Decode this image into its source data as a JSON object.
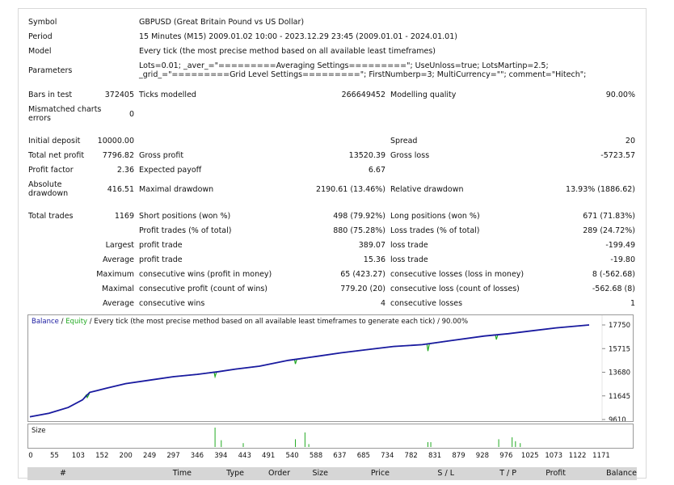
{
  "report": {
    "symbol": {
      "label": "Symbol",
      "value": "GBPUSD (Great Britain Pound vs US Dollar)"
    },
    "period": {
      "label": "Period",
      "value": "15 Minutes (M15) 2009.01.02 10:00 - 2023.12.29 23:45 (2009.01.01 - 2024.01.01)"
    },
    "model": {
      "label": "Model",
      "value": "Every tick (the most precise method based on all available least timeframes)"
    },
    "parameters": {
      "label": "Parameters",
      "value": "Lots=0.01; _aver_=\"=========Averaging Settings=========\"; UseUnloss=true; LotsMartinp=2.5; _grid_=\"=========Grid Level Settings=========\"; FirstNumberp=3; MultiCurrency=\"\"; comment=\"Hitech\";"
    },
    "bars_in_test": {
      "label": "Bars in test",
      "value": "372405"
    },
    "ticks_modelled": {
      "label": "Ticks modelled",
      "value": "266649452"
    },
    "modelling_quality": {
      "label": "Modelling quality",
      "value": "90.00%"
    },
    "mismatched": {
      "label": "Mismatched charts errors",
      "value": "0"
    },
    "initial_deposit": {
      "label": "Initial deposit",
      "value": "10000.00"
    },
    "spread": {
      "label": "Spread",
      "value": "20"
    },
    "total_net_profit": {
      "label": "Total net profit",
      "value": "7796.82"
    },
    "gross_profit": {
      "label": "Gross profit",
      "value": "13520.39"
    },
    "gross_loss": {
      "label": "Gross loss",
      "value": "-5723.57"
    },
    "profit_factor": {
      "label": "Profit factor",
      "value": "2.36"
    },
    "expected_payoff": {
      "label": "Expected payoff",
      "value": "6.67"
    },
    "absolute_drawdown": {
      "label": "Absolute drawdown",
      "value": "416.51"
    },
    "maximal_drawdown": {
      "label": "Maximal drawdown",
      "value": "2190.61 (13.46%)"
    },
    "relative_drawdown": {
      "label": "Relative drawdown",
      "value": "13.93% (1886.62)"
    },
    "total_trades": {
      "label": "Total trades",
      "value": "1169"
    },
    "short_positions": {
      "label": "Short positions (won %)",
      "value": "498 (79.92%)"
    },
    "long_positions": {
      "label": "Long positions (won %)",
      "value": "671 (71.83%)"
    },
    "profit_trades": {
      "label": "Profit trades (% of total)",
      "value": "880 (75.28%)"
    },
    "loss_trades": {
      "label": "Loss trades (% of total)",
      "value": "289 (24.72%)"
    },
    "largest": {
      "label": "Largest",
      "profit_label": "profit trade",
      "profit": "389.07",
      "loss_label": "loss trade",
      "loss": "-199.49"
    },
    "average": {
      "label": "Average",
      "profit_label": "profit trade",
      "profit": "15.36",
      "loss_label": "loss trade",
      "loss": "-19.80"
    },
    "maximum": {
      "label": "Maximum",
      "profit_label": "consecutive wins (profit in money)",
      "profit": "65 (423.27)",
      "loss_label": "consecutive losses (loss in money)",
      "loss": "8 (-562.68)"
    },
    "maximal": {
      "label": "Maximal",
      "profit_label": "consecutive profit (count of wins)",
      "profit": "779.20 (20)",
      "loss_label": "consecutive loss (count of losses)",
      "loss": "-562.68 (8)"
    },
    "average_consec": {
      "label": "Average",
      "profit_label": "consecutive wins",
      "profit": "4",
      "loss_label": "consecutive losses",
      "loss": "1"
    }
  },
  "chart": {
    "legend_balance": "Balance",
    "legend_sep": " / ",
    "legend_equity": "Equity",
    "legend_rest": " / Every tick (the most precise method based on all available least timeframes to generate each tick) / 90.00%",
    "size_label": "Size",
    "colors": {
      "balance": "#1a1aa0",
      "equity": "#22aa22",
      "size_bars": "#22aa22"
    }
  },
  "chart_data": {
    "type": "line",
    "ylim": [
      9610,
      17750
    ],
    "yticks": [
      "17750",
      "15715",
      "13680",
      "11645",
      "9610"
    ],
    "xticks": [
      "0",
      "55",
      "103",
      "152",
      "200",
      "249",
      "297",
      "346",
      "394",
      "443",
      "491",
      "540",
      "588",
      "637",
      "685",
      "734",
      "782",
      "831",
      "879",
      "928",
      "976",
      "1025",
      "1073",
      "1122",
      "1171"
    ],
    "xlim": [
      0,
      1169
    ],
    "series": [
      {
        "name": "Balance",
        "x": [
          0,
          40,
          80,
          110,
          125,
          140,
          160,
          200,
          250,
          300,
          350,
          394,
          430,
          480,
          540,
          600,
          650,
          700,
          760,
          820,
          880,
          950,
          1000,
          1050,
          1100,
          1169
        ],
        "values": [
          9850,
          10150,
          10650,
          11300,
          11950,
          12100,
          12300,
          12700,
          13000,
          13300,
          13500,
          13730,
          13950,
          14200,
          14700,
          15050,
          15350,
          15600,
          15900,
          16050,
          16400,
          16800,
          17000,
          17250,
          17500,
          17750
        ]
      }
    ],
    "equity_dips": [
      {
        "x": 120,
        "values": [
          11500
        ]
      },
      {
        "x": 387,
        "values": [
          13300
        ]
      },
      {
        "x": 555,
        "values": [
          14400
        ]
      },
      {
        "x": 832,
        "values": [
          15500
        ]
      },
      {
        "x": 975,
        "values": [
          16500
        ]
      }
    ],
    "size_bars": [
      {
        "x": 387,
        "value": 1.0
      },
      {
        "x": 400,
        "value": 0.35
      },
      {
        "x": 446,
        "value": 0.2
      },
      {
        "x": 555,
        "value": 0.4
      },
      {
        "x": 575,
        "value": 0.75
      },
      {
        "x": 583,
        "value": 0.15
      },
      {
        "x": 832,
        "value": 0.25
      },
      {
        "x": 838,
        "value": 0.25
      },
      {
        "x": 980,
        "value": 0.4
      },
      {
        "x": 1008,
        "value": 0.5
      },
      {
        "x": 1015,
        "value": 0.3
      },
      {
        "x": 1025,
        "value": 0.2
      }
    ]
  },
  "table_header": [
    "#",
    "Time",
    "Type",
    "Order",
    "Size",
    "Price",
    "S / L",
    "T / P",
    "Profit",
    "Balance"
  ]
}
